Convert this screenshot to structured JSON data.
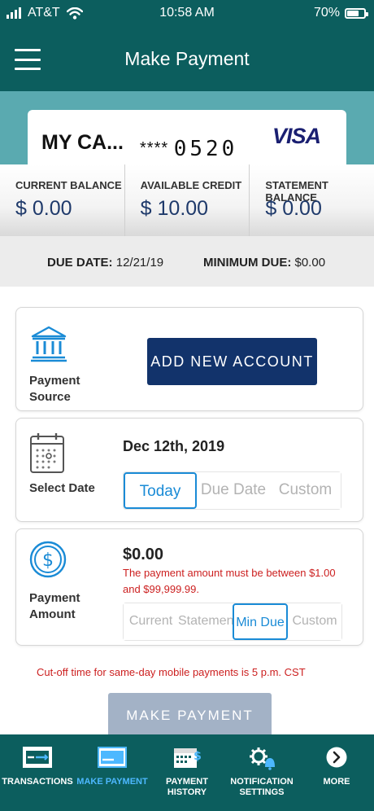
{
  "status_bar": {
    "carrier": "AT&T",
    "time": "10:58 AM",
    "battery": "70%",
    "battery_level": 0.7
  },
  "header": {
    "title": "Make Payment"
  },
  "card": {
    "name": "MY CA...",
    "masked_prefix": "****",
    "last_digits": "0520",
    "brand": "VISA"
  },
  "balances": [
    {
      "label": "CURRENT BALANCE",
      "value": "$ 0.00"
    },
    {
      "label": "AVAILABLE CREDIT",
      "value": "$ 10.00"
    },
    {
      "label": "STATEMENT BALANCE",
      "value": "$ 0.00"
    }
  ],
  "due": {
    "due_date_label": "DUE DATE:",
    "due_date_value": "12/21/19",
    "min_due_label": "MINIMUM DUE:",
    "min_due_value": "$0.00"
  },
  "payment_source": {
    "label_line1": "Payment",
    "label_line2": "Source",
    "add_button": "ADD NEW ACCOUNT"
  },
  "select_date": {
    "label": "Select Date",
    "value": "Dec 12th, 2019",
    "options": [
      "Today",
      "Due Date",
      "Custom"
    ],
    "selected": "Today"
  },
  "payment_amount": {
    "label_line1": "Payment",
    "label_line2": "Amount",
    "value": "$0.00",
    "error_line1": "The payment amount must be between $1.00",
    "error_line2": "and $99,999.99.",
    "options": [
      "Current",
      "Statemen",
      "Min Due",
      "Custom"
    ],
    "selected": "Min Due"
  },
  "cutoff_text": "Cut-off time for same-day mobile payments is 5 p.m. CST",
  "make_payment_button": "MAKE PAYMENT",
  "bottom_nav": [
    {
      "label": "TRANSACTIONS",
      "icon": "transactions-icon",
      "active": false
    },
    {
      "label": "MAKE PAYMENT",
      "icon": "card-payment-icon",
      "active": true
    },
    {
      "label": "PAYMENT\nHISTORY",
      "icon": "calendar-dollar-icon",
      "active": false
    },
    {
      "label": "NOTIFICATION\nSETTINGS",
      "icon": "gear-bell-icon",
      "active": false
    },
    {
      "label": "MORE",
      "icon": "chevron-right-circle-icon",
      "active": false
    }
  ],
  "colors": {
    "header": "#0c5e5e",
    "card_band": "#5aaab0",
    "primary_button": "#12336b",
    "disabled_button": "#a3b2c6",
    "selected_segment": "#1a8bd6",
    "error": "#cc1f1f",
    "nav_active": "#4db8ff"
  }
}
